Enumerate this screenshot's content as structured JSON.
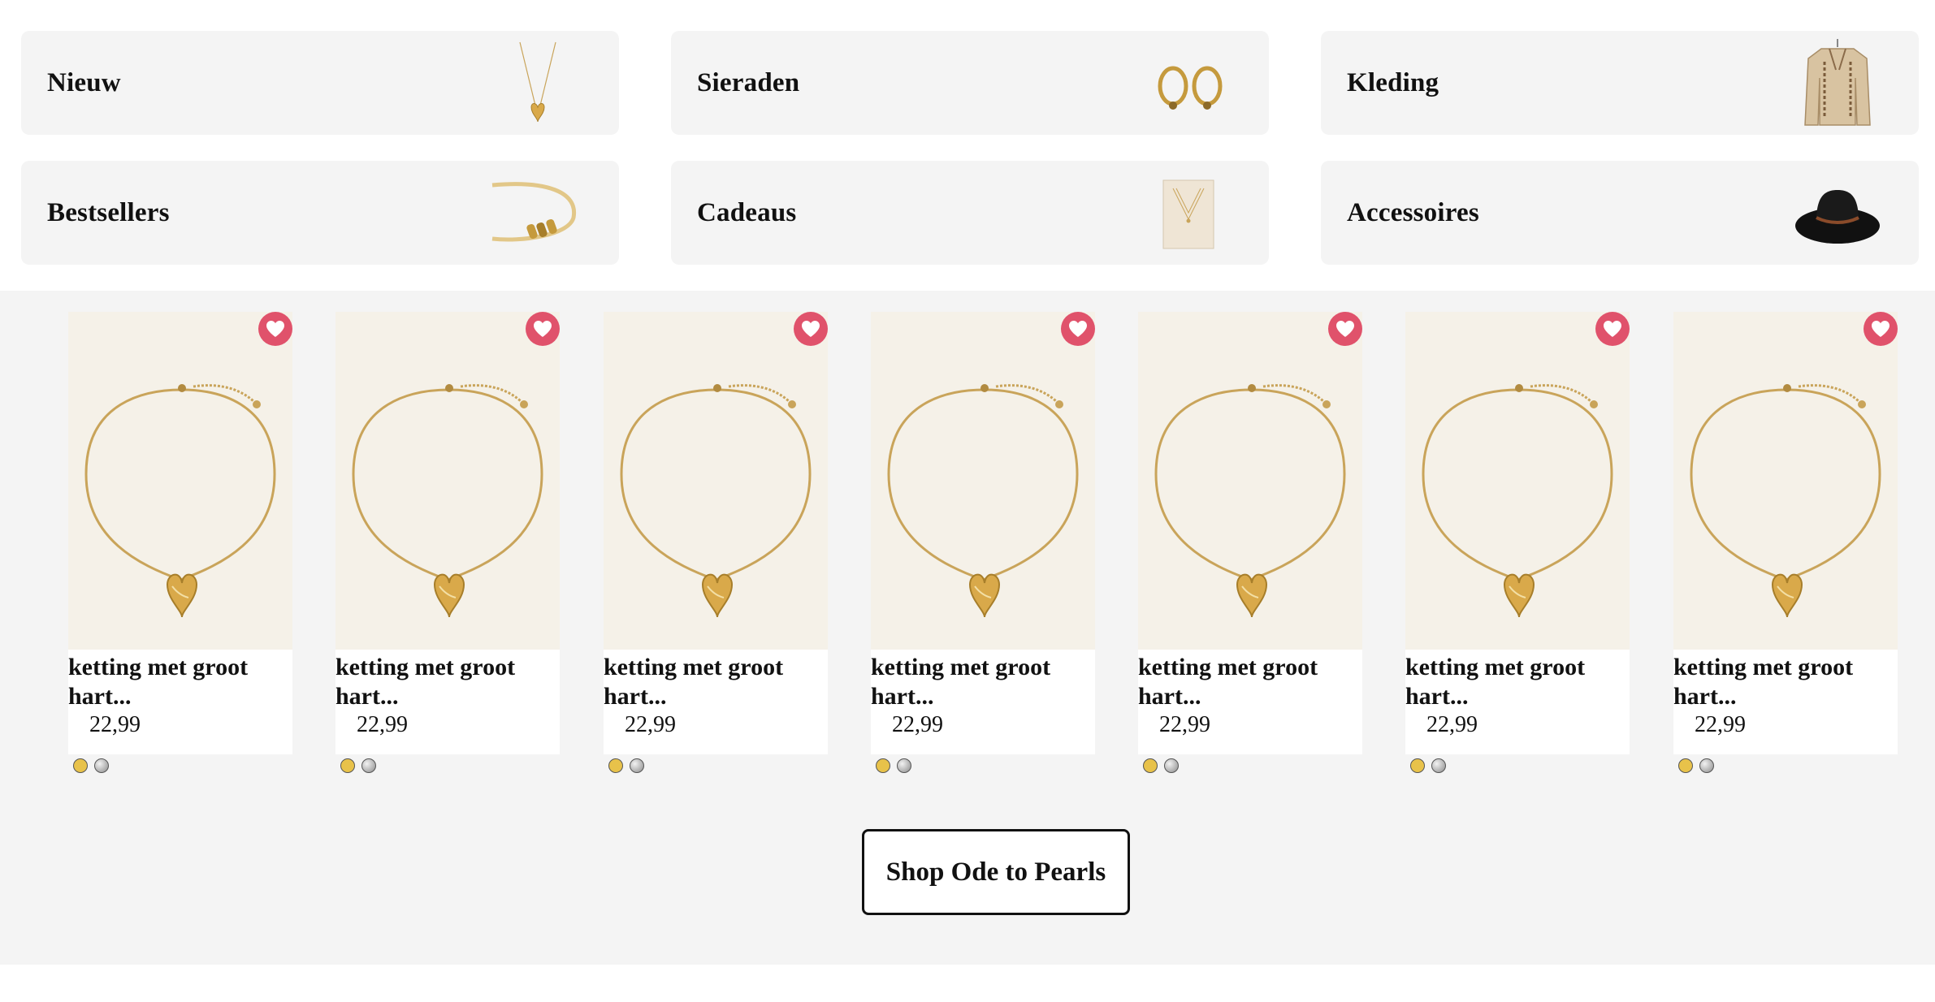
{
  "categories": [
    {
      "label": "Nieuw",
      "image": "necklace-heart-pendant"
    },
    {
      "label": "Sieraden",
      "image": "hoop-earrings"
    },
    {
      "label": "Kleding",
      "image": "cardigan"
    },
    {
      "label": "Bestsellers",
      "image": "bangle-bracelet"
    },
    {
      "label": "Cadeaus",
      "image": "gift-card-necklace"
    },
    {
      "label": "Accessoires",
      "image": "black-fedora-hat"
    }
  ],
  "products": [
    {
      "title": "ketting met groot hart...",
      "price": "22,99",
      "colors": [
        "#e8c24a",
        "silver"
      ]
    },
    {
      "title": "ketting met groot hart...",
      "price": "22,99",
      "colors": [
        "#e8c24a",
        "silver"
      ]
    },
    {
      "title": "ketting met groot hart...",
      "price": "22,99",
      "colors": [
        "#e8c24a",
        "silver"
      ]
    },
    {
      "title": "ketting met groot hart...",
      "price": "22,99",
      "colors": [
        "#e8c24a",
        "silver"
      ]
    },
    {
      "title": "ketting met groot hart...",
      "price": "22,99",
      "colors": [
        "#e8c24a",
        "silver"
      ]
    },
    {
      "title": "ketting met groot hart...",
      "price": "22,99",
      "colors": [
        "#e8c24a",
        "silver"
      ]
    },
    {
      "title": "ketting met groot hart...",
      "price": "22,99",
      "colors": [
        "#e8c24a",
        "silver"
      ]
    }
  ],
  "cta": {
    "label": "Shop Ode to Pearls"
  },
  "icons": {
    "wishlist": "heart-icon"
  },
  "colors": {
    "wishlist_bg": "#e0526b",
    "section_bg": "#f4f4f4",
    "tile_bg": "#f4f4f4"
  }
}
